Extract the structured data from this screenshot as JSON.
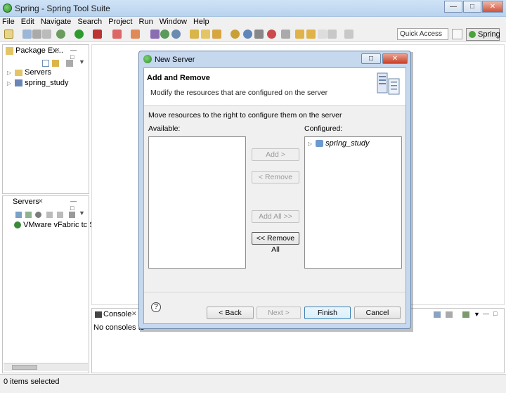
{
  "app": {
    "title": "Spring - Spring Tool Suite"
  },
  "menu": [
    "File",
    "Edit",
    "Navigate",
    "Search",
    "Project",
    "Run",
    "Window",
    "Help"
  ],
  "toolbar": {
    "quick_access": "Quick Access",
    "perspective": "Spring"
  },
  "package_explorer": {
    "tab": "Package Ex...",
    "items": [
      {
        "label": "Servers"
      },
      {
        "label": "spring_study"
      }
    ]
  },
  "servers_view": {
    "tab": "Servers",
    "items": [
      {
        "label": "VMware vFabric tc Ser"
      }
    ]
  },
  "console": {
    "tab": "Console",
    "message": "No consoles to"
  },
  "status": {
    "text": "0 items selected"
  },
  "dialog": {
    "title": "New Server",
    "heading": "Add and Remove",
    "description": "Modify the resources that are configured on the server",
    "instruction": "Move resources to the right to configure them on the server",
    "available_label": "Available:",
    "configured_label": "Configured:",
    "available_items": [],
    "configured_items": [
      {
        "label": "spring_study"
      }
    ],
    "buttons": {
      "add": "Add >",
      "remove": "< Remove",
      "add_all": "Add All >>",
      "remove_all": "<< Remove All",
      "back": "< Back",
      "next": "Next >",
      "finish": "Finish",
      "cancel": "Cancel"
    }
  }
}
